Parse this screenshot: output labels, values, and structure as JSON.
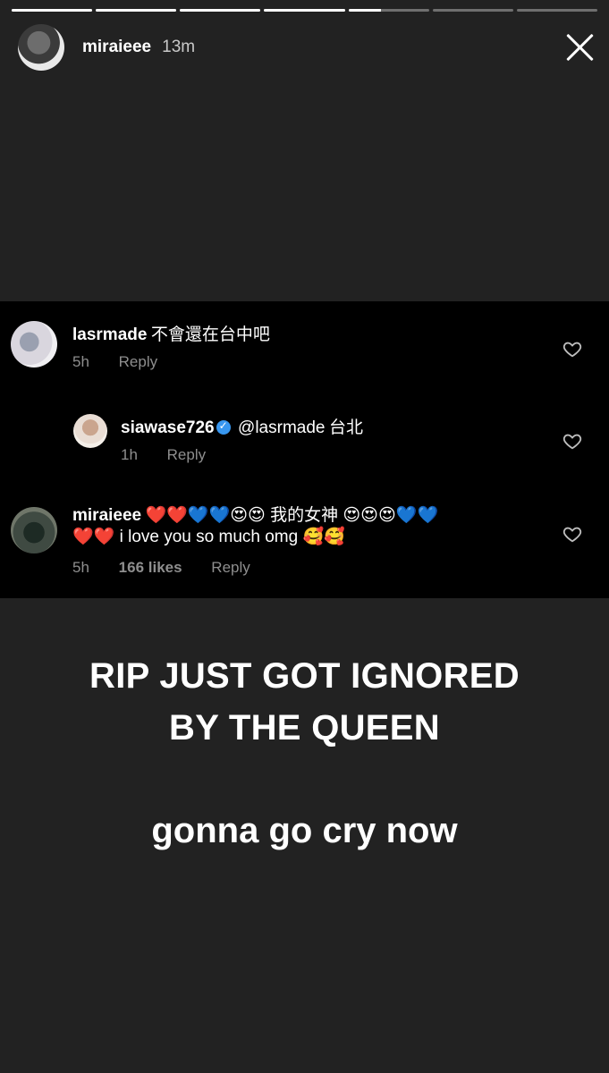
{
  "story": {
    "username": "miraieee",
    "time_ago": "13m",
    "progress": [
      1,
      1,
      1,
      1,
      0.4,
      0,
      0
    ]
  },
  "comments": [
    {
      "username": "lasrmade",
      "text": "不會還在台中吧",
      "time": "5h",
      "reply_label": "Reply"
    },
    {
      "username": "siawase726",
      "mention": "@lasrmade",
      "text": "台北",
      "time": "1h",
      "reply_label": "Reply"
    },
    {
      "username": "miraieee",
      "text_line1": "❤️❤️💙💙😍😍 我的女神 😍😍😍💙💙",
      "text_line2": "❤️❤️ i love you so much omg 🥰🥰",
      "time": "5h",
      "likes": "166 likes",
      "reply_label": "Reply"
    }
  ],
  "caption": {
    "line1": "RIP JUST GOT IGNORED",
    "line2": "BY THE QUEEN",
    "line3": "gonna go cry now"
  },
  "icons": {
    "heart": "heart-outline-icon",
    "close": "close-icon",
    "verified": "verified-badge-icon"
  },
  "colors": {
    "background": "#222222",
    "comment_panel": "#000000",
    "verified": "#3897f0",
    "meta": "#8e8e8e"
  }
}
